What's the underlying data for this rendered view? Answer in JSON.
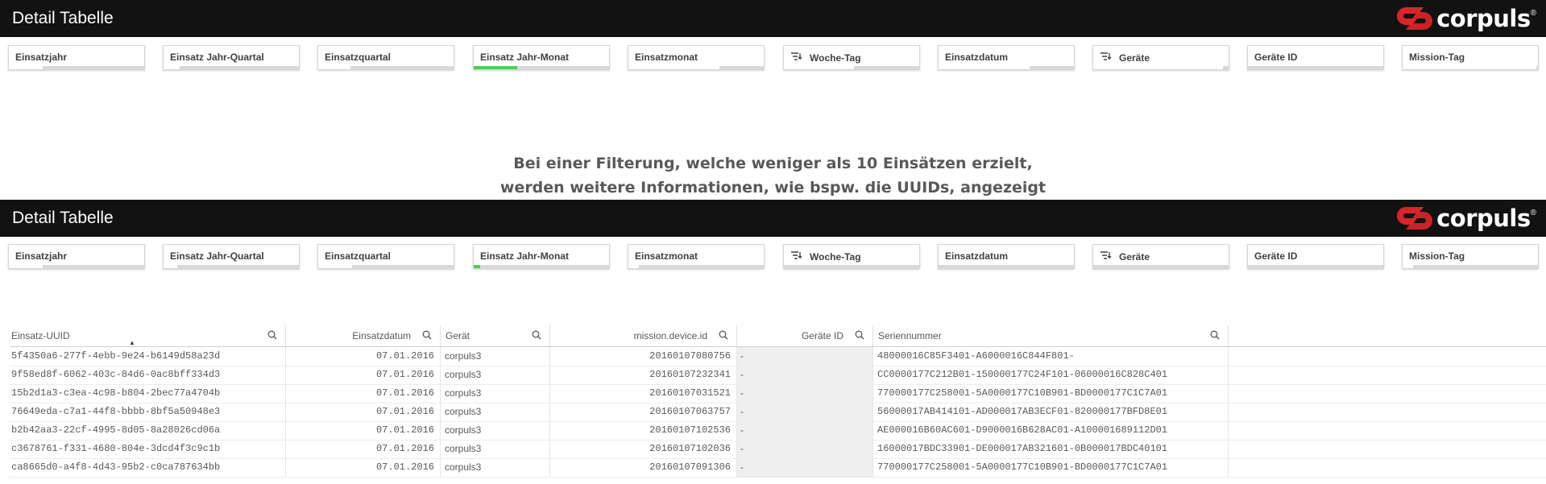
{
  "sections": [
    {
      "header": {
        "title": "Detail Tabelle",
        "logo_text": "corpuls",
        "logo_mark": "®"
      }
    },
    {
      "header": {
        "title": "Detail Tabelle",
        "logo_text": "corpuls",
        "logo_mark": "®"
      }
    }
  ],
  "filters_top": [
    {
      "label": "Einsatzjahr",
      "icon": "",
      "fill": 0.25,
      "bar": "gray"
    },
    {
      "label": "Einsatz Jahr-Quartal",
      "icon": "",
      "fill": 0.12,
      "bar": "gray"
    },
    {
      "label": "Einsatzquartal",
      "icon": "",
      "fill": 0.24,
      "bar": "gray"
    },
    {
      "label": "Einsatz Jahr-Monat",
      "icon": "",
      "fill": 0.32,
      "bar": "green"
    },
    {
      "label": "Einsatzmonat",
      "icon": "",
      "fill": 0.67,
      "bar": "gray"
    },
    {
      "label": "Woche-Tag",
      "icon": "drilldown-icon",
      "fill": 0.52,
      "bar": "gray"
    },
    {
      "label": "Einsatzdatum",
      "icon": "",
      "fill": 0.67,
      "bar": "gray"
    },
    {
      "label": "Geräte",
      "icon": "drilldown-icon",
      "fill": 0.96,
      "bar": "gray"
    },
    {
      "label": "Geräte ID",
      "icon": "",
      "fill": 0.0,
      "bar": "gray"
    },
    {
      "label": "Mission-Tag",
      "icon": "",
      "fill": 0.99,
      "bar": "gray"
    }
  ],
  "filters_bottom": [
    {
      "label": "Einsatzjahr",
      "icon": "",
      "fill": 0.25,
      "bar": "gray"
    },
    {
      "label": "Einsatz Jahr-Quartal",
      "icon": "",
      "fill": 0.1,
      "bar": "gray"
    },
    {
      "label": "Einsatzquartal",
      "icon": "",
      "fill": 0.25,
      "bar": "gray"
    },
    {
      "label": "Einsatz Jahr-Monat",
      "icon": "",
      "fill": 0.05,
      "bar": "green"
    },
    {
      "label": "Einsatzmonat",
      "icon": "",
      "fill": 0.08,
      "bar": "gray"
    },
    {
      "label": "Woche-Tag",
      "icon": "drilldown-icon",
      "fill": 0.0,
      "bar": "gray"
    },
    {
      "label": "Einsatzdatum",
      "icon": "",
      "fill": 0.0,
      "bar": "green"
    },
    {
      "label": "Geräte",
      "icon": "drilldown-icon",
      "fill": 0.0,
      "bar": "gray"
    },
    {
      "label": "Geräte ID",
      "icon": "",
      "fill": 0.0,
      "bar": "gray"
    },
    {
      "label": "Mission-Tag",
      "icon": "",
      "fill": 0.08,
      "bar": "gray"
    }
  ],
  "message": {
    "line1": "Bei einer Filterung, welche weniger als 10 Einsätzen erzielt,",
    "line2": "werden weitere Informationen, wie bspw. die UUIDs, angezeigt"
  },
  "table": {
    "columns": [
      {
        "label": "Einsatz-UUID",
        "align": "left",
        "sorted": true
      },
      {
        "label": "Einsatzdatum",
        "align": "right",
        "sorted": false
      },
      {
        "label": "Gerät",
        "align": "left",
        "sorted": false
      },
      {
        "label": "mission.device.id",
        "align": "right",
        "sorted": false
      },
      {
        "label": "Geräte ID",
        "align": "right",
        "sorted": false
      },
      {
        "label": "Seriennummer",
        "align": "left",
        "sorted": false
      }
    ],
    "rows": [
      [
        "5f4350a6-277f-4ebb-9e24-b6149d58a23d",
        "07.01.2016",
        "corpuls3",
        "20160107080756",
        "-",
        "48000016C85F3401-A6000016C844F801-"
      ],
      [
        "9f58ed8f-6062-403c-84d6-0ac8bff334d3",
        "07.01.2016",
        "corpuls3",
        "20160107232341",
        "-",
        "CC0000177C212B01-150000177C24F101-06000016C828C401"
      ],
      [
        "15b2d1a3-c3ea-4c98-b804-2bec77a4704b",
        "07.01.2016",
        "corpuls3",
        "20160107031521",
        "-",
        "770000177C258001-5A0000177C10B901-BD0000177C1C7A01"
      ],
      [
        "76649eda-c7a1-44f8-bbbb-8bf5a50948e3",
        "07.01.2016",
        "corpuls3",
        "20160107063757",
        "-",
        "56000017AB414101-AD000017AB3ECF01-820000177BFD8E01"
      ],
      [
        "b2b42aa3-22cf-4995-8d05-8a28026cd06a",
        "07.01.2016",
        "corpuls3",
        "20160107102536",
        "-",
        "AE000016B60AC601-D9000016B628AC01-A100001689112D01"
      ],
      [
        "c3678761-f331-4680-804e-3dcd4f3c9c1b",
        "07.01.2016",
        "corpuls3",
        "20160107102036",
        "-",
        "16000017BDC33901-DE000017AB321601-0B000017BDC40101"
      ],
      [
        "ca8665d0-a4f8-4d43-95b2-c0ca787634bb",
        "07.01.2016",
        "corpuls3",
        "20160107091306",
        "-",
        "770000177C258001-5A0000177C10B901-BD0000177C1C7A01"
      ]
    ]
  },
  "colors": {
    "header_bg": "#121212",
    "accent_red": "#d9252a",
    "selection_green": "#52cc52",
    "text": "#595959"
  }
}
